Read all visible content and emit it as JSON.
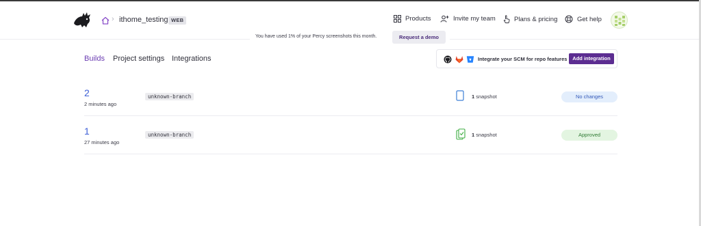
{
  "header": {
    "project_name": "ithome_testing",
    "badge": "WEB",
    "breadcrumb_separator": "›",
    "nav": {
      "products": "Products",
      "invite": "Invite my team",
      "plans": "Plans & pricing",
      "help": "Get help"
    }
  },
  "usage_banner": {
    "text": "You have used 1% of your Percy screenshots this month.",
    "demo_button": "Request a demo"
  },
  "tabs": {
    "builds": "Builds",
    "project_settings": "Project settings",
    "integrations": "Integrations"
  },
  "scm": {
    "icons": [
      "github-icon",
      "gitlab-icon",
      "bitbucket-icon"
    ],
    "text": "Integrate your SCM for repo features",
    "button": "Add integration"
  },
  "builds": [
    {
      "number": "2",
      "time": "2 minutes ago",
      "branch": "unknown-branch",
      "snapshot_count": "1",
      "snapshot_label": "snapshot",
      "status": "No changes"
    },
    {
      "number": "1",
      "time": "27 minutes ago",
      "branch": "unknown-branch",
      "snapshot_count": "1",
      "snapshot_label": "snapshot",
      "status": "Approved"
    }
  ],
  "colors": {
    "accent_purple": "#5c2d91",
    "active_tab": "#6a3bb1",
    "build_link": "#3d5fd6",
    "no_changes_bg": "#e3eefc",
    "approved_bg": "#e3f5e1"
  }
}
